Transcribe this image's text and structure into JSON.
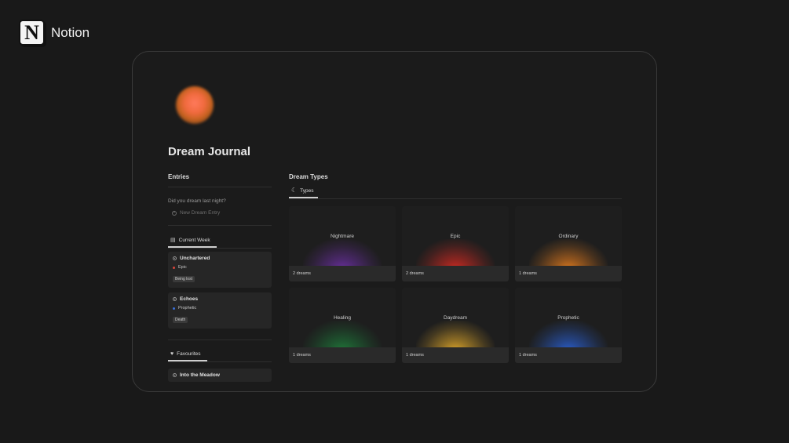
{
  "brand": {
    "logo_letter": "N",
    "name": "Notion"
  },
  "page": {
    "title": "Dream Journal",
    "cover_icon": "gradient-orb-icon"
  },
  "entries": {
    "heading": "Entries",
    "prompt": "Did you dream last night?",
    "new_entry_label": "New Dream Entry",
    "current_week_tab": "Current Week",
    "cards": [
      {
        "title": "Unchartered",
        "type": "Epic",
        "type_color": "#d9453b",
        "tag": "Being lost"
      },
      {
        "title": "Echoes",
        "type": "Prophetic",
        "type_color": "#3a6fd8",
        "tag": "Death"
      }
    ],
    "favourites_tab": "Favourites",
    "favourite_cards": [
      {
        "title": "Into the Meadow"
      }
    ]
  },
  "dream_types": {
    "heading": "Dream Types",
    "tab_label": "Types",
    "tiles": [
      {
        "name": "Nightmare",
        "count": "2 dreams",
        "color": "#6a2fa0"
      },
      {
        "name": "Epic",
        "count": "2 dreams",
        "color": "#d22a22"
      },
      {
        "name": "Ordinary",
        "count": "1 dreams",
        "color": "#e07a1e"
      },
      {
        "name": "Healing",
        "count": "1 dreams",
        "color": "#1f7a3a"
      },
      {
        "name": "Daydream",
        "count": "1 dreams",
        "color": "#e0a82a"
      },
      {
        "name": "Prophetic",
        "count": "1 dreams",
        "color": "#2a5fd0"
      }
    ]
  }
}
